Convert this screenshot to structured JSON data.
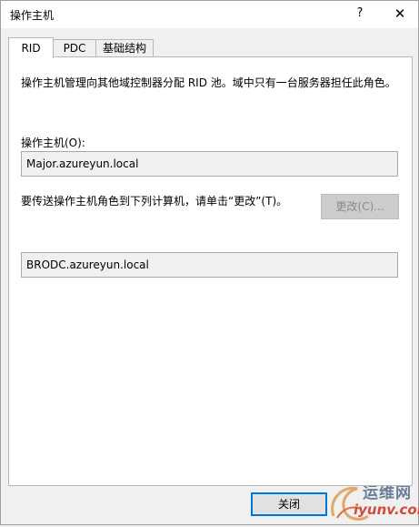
{
  "window": {
    "title": "操作主机",
    "help_glyph": "?",
    "close_glyph": "✕"
  },
  "tabs": [
    {
      "label": "RID",
      "active": true
    },
    {
      "label": "PDC",
      "active": false
    },
    {
      "label": "基础结构",
      "active": false
    }
  ],
  "rid": {
    "description": "操作主机管理向其他域控制器分配 RID 池。域中只有一台服务器担任此角色。",
    "owner_label": "操作主机(O):",
    "owner_value": "Major.azureyun.local",
    "transfer_text": "要传送操作主机角色到下列计算机，请单击“更改”(T)。",
    "change_button": "更改(C)...",
    "target_value": "BRODC.azureyun.local"
  },
  "footer": {
    "close_button": "关闭"
  },
  "watermark": {
    "brand": "运维网",
    "url": "iyunv.com"
  }
}
